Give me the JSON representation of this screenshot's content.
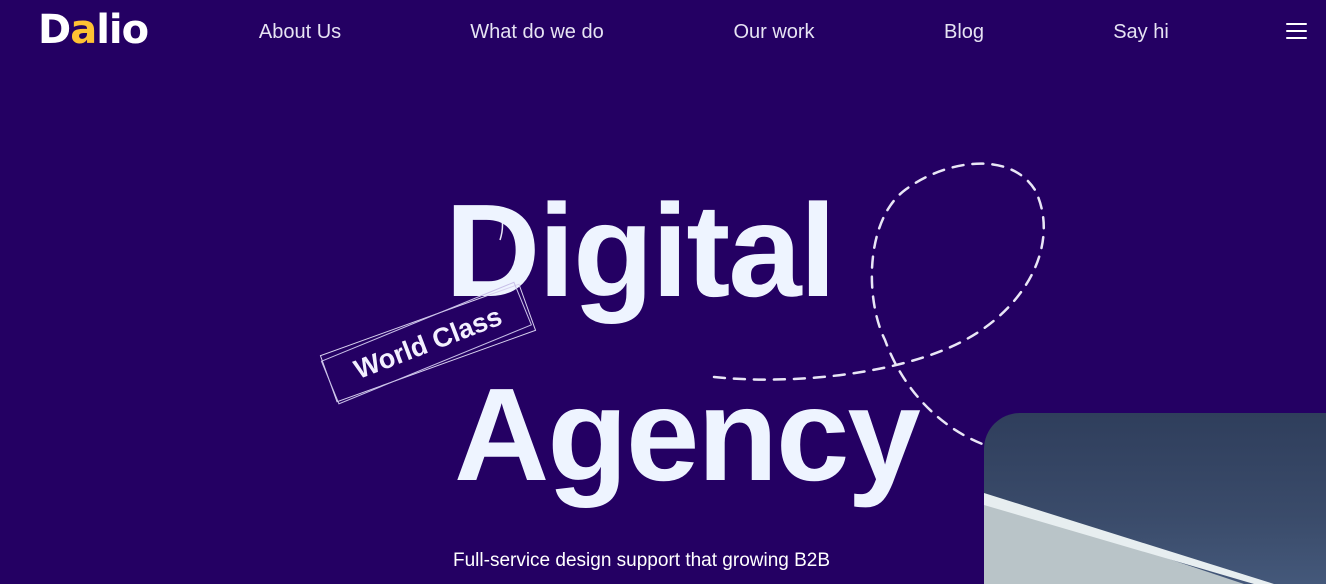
{
  "header": {
    "logo": {
      "prefix": "D",
      "accent_letter": "a",
      "suffix": "lio",
      "accent_color": "#ffc233"
    },
    "nav": [
      {
        "label": "About Us"
      },
      {
        "label": "What do we do"
      },
      {
        "label": "Our work"
      },
      {
        "label": "Blog"
      },
      {
        "label": "Say hi"
      }
    ],
    "menu_icon": "hamburger-menu-icon"
  },
  "hero": {
    "title_line1": "Digital",
    "title_line2": "Agency",
    "badge_label": "World Class",
    "subtitle": "Full-service design support that growing B2B"
  },
  "colors": {
    "background": "#240063",
    "title": "#eef4ff",
    "nav_text": "#e6e3f3"
  }
}
